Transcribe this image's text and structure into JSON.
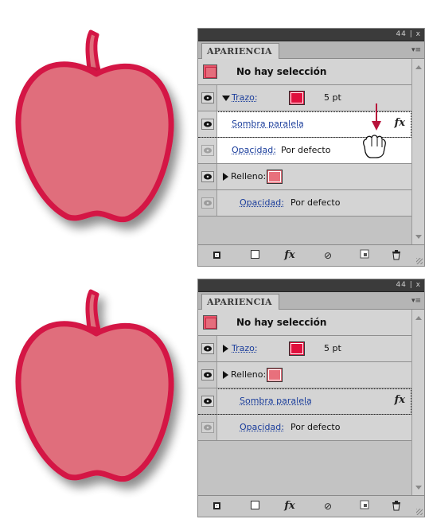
{
  "colors": {
    "apple_fill": "#e06e7c",
    "apple_stroke": "#d41645",
    "stroke_swatch": "#e0103d",
    "fill_swatch": "#e8707c",
    "arrow": "#b8123a"
  },
  "top_panel": {
    "title_controls": "44 | x",
    "tab_label": "APARIENCIA",
    "no_selection": "No hay selección",
    "stroke_label": "Trazo:",
    "stroke_weight": "5 pt",
    "drop_shadow": "Sombra paralela",
    "fx_label": "fx",
    "opacity_label": "Opacidad:",
    "opacity_value": "Por defecto",
    "fill_label": "Relleno:",
    "opacity2_label": "Opacidad:",
    "opacity2_value": "Por defecto"
  },
  "bottom_panel": {
    "title_controls": "44 | x",
    "tab_label": "APARIENCIA",
    "no_selection": "No hay selección",
    "stroke_label": "Trazo:",
    "stroke_weight": "5 pt",
    "fill_label": "Relleno:",
    "drop_shadow": "Sombra paralela",
    "fx_label": "fx",
    "opacity_label": "Opacidad:",
    "opacity_value": "Por defecto"
  },
  "toolbar": {
    "fx_label": "fx",
    "clear_symbol": "⊘",
    "trash_symbol": "🗑"
  },
  "icons": [
    "apple-illustration",
    "eye-icon",
    "disclosure-triangle-icon",
    "fx-icon",
    "hand-cursor-icon",
    "down-arrow-icon",
    "add-stroke-icon",
    "add-fill-icon",
    "clear-icon",
    "duplicate-icon",
    "trash-icon",
    "panel-menu-icon"
  ]
}
